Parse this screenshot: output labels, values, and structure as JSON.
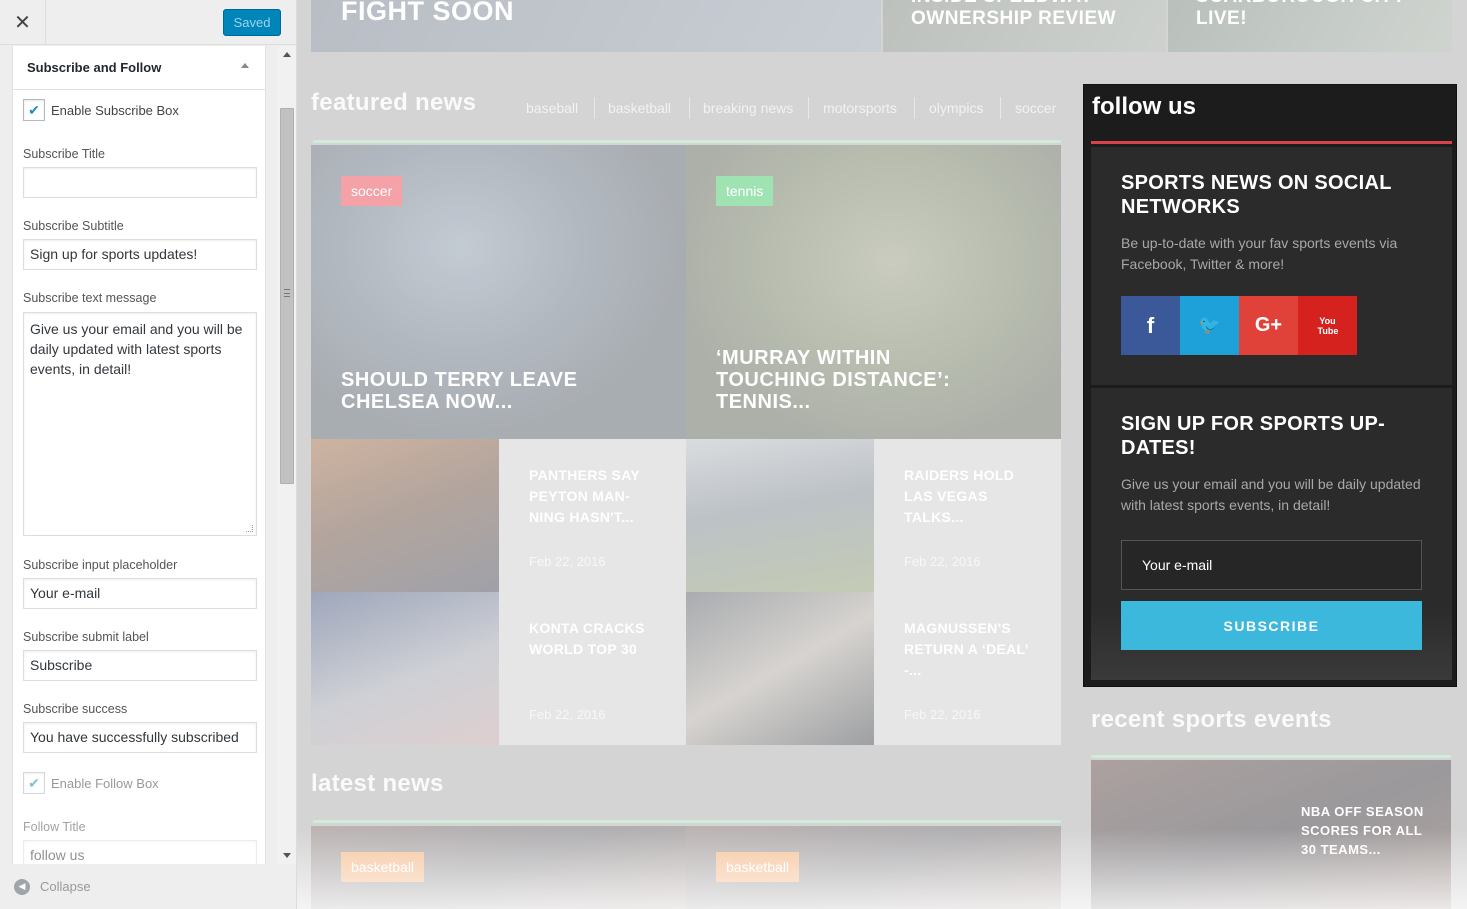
{
  "panel": {
    "close_icon": "✕",
    "saved_label": "Saved",
    "section_title": "Subscribe and Follow",
    "enable_subscribe": {
      "label": "Enable Subscribe Box",
      "checked": true
    },
    "subscribe_title": {
      "label": "Subscribe Title",
      "value": ""
    },
    "subscribe_subtitle": {
      "label": "Subscribe Subtitle",
      "value": "Sign up for sports updates!"
    },
    "subscribe_text": {
      "label": "Subscribe text message",
      "value": "Give us your email and you will be daily updated with latest sports events, in detail!"
    },
    "subscribe_placeholder": {
      "label": "Subscribe input placeholder",
      "value": "Your e-mail"
    },
    "subscribe_submit": {
      "label": "Subscribe submit label",
      "value": "Subscribe"
    },
    "subscribe_success": {
      "label": "Subscribe success",
      "value": "You have successfully subscribed"
    },
    "enable_follow": {
      "label": "Enable Follow Box",
      "checked": true
    },
    "follow_title": {
      "label": "Follow Title",
      "value": "follow us"
    },
    "collapse_label": "Collapse"
  },
  "preview": {
    "top_stories": [
      "FIGHT SOON",
      "INSIDE SPEEDWAY OWNERSHIP REVIEW",
      "SCARBOROUGH CITY LIVE!"
    ],
    "featured": {
      "heading": "featured news",
      "categories": [
        "baseball",
        "basketball",
        "breaking news",
        "motorsports",
        "olympics",
        "soccer"
      ],
      "big_cards": [
        {
          "tag": "soccer",
          "tag_color": "#f5a1a8",
          "title": "SHOULD TERRY LEAVE CHELSEA NOW..."
        },
        {
          "tag": "tennis",
          "tag_color": "#9fe3b3",
          "title": "‘MURRAY WITHIN TOUCHING DISTANCE’: TENNIS..."
        }
      ],
      "small_cards": [
        {
          "title": "PANTHERS SAY PEYTON MAN-NING HASN'T...",
          "date": "Feb 22, 2016"
        },
        {
          "title": "RAIDERS HOLD LAS VEGAS TALKS...",
          "date": "Feb 22, 2016"
        },
        {
          "title": "KONTA CRACKS WORLD TOP 30",
          "date": "Feb 22, 2016"
        },
        {
          "title": "MAGNUSSEN'S RETURN A ‘DEAL’ -...",
          "date": "Feb 22, 2016"
        }
      ]
    },
    "latest": {
      "heading": "latest news",
      "tags": [
        {
          "label": "basketball",
          "color": "#f6c7a0"
        },
        {
          "label": "basketball",
          "color": "#f6c7a0"
        }
      ]
    },
    "follow_widget": {
      "title": "follow us",
      "social_heading": "SPORTS NEWS ON SOCIAL NETWORKS",
      "social_text": "Be up-to-date with your fav sports events via Facebook, Twitter & more!",
      "social": [
        {
          "icon": "facebook-icon",
          "glyph": "f",
          "color": "#3b5998"
        },
        {
          "icon": "twitter-icon",
          "glyph": "🐦",
          "color": "#1da1d8"
        },
        {
          "icon": "google-plus-icon",
          "glyph": "G+",
          "color": "#e0423a"
        },
        {
          "icon": "youtube-icon",
          "glyph": "You Tube",
          "color": "#d6221f"
        }
      ],
      "signup_heading": "SIGN UP FOR SPORTS UP-DATES!",
      "signup_text": "Give us your email and you will be daily updated with latest sports events, in detail!",
      "email_placeholder": "Your e-mail",
      "subscribe_label": "SUBSCRIBE"
    },
    "recent": {
      "heading": "recent sports events",
      "card_title": "NBA OFF SEASON SCORES FOR ALL 30 TEAMS..."
    }
  }
}
